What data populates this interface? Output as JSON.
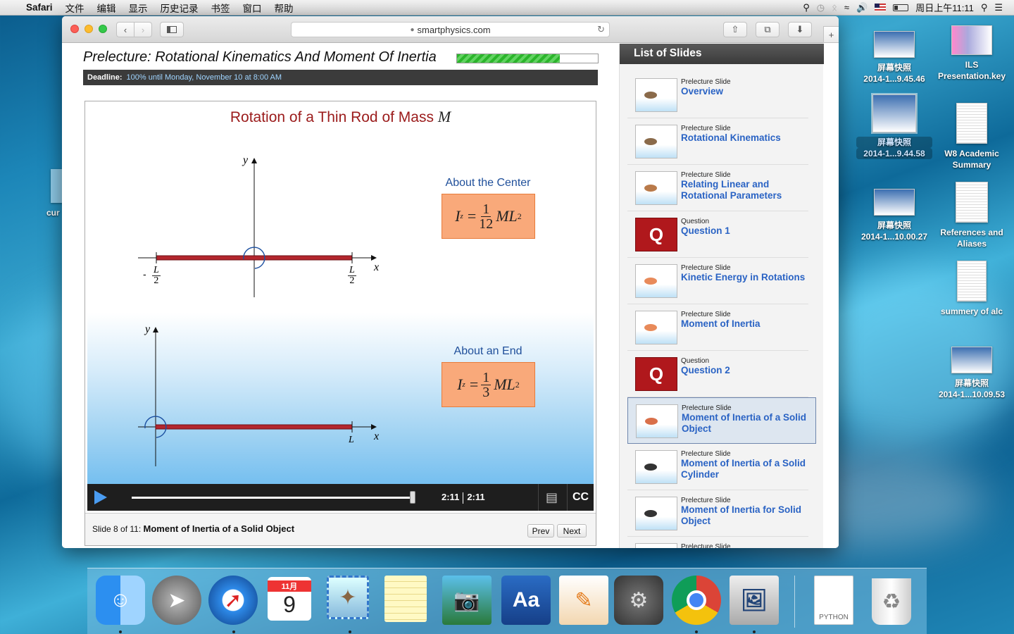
{
  "menubar": {
    "app": "Safari",
    "items": [
      "文件",
      "编辑",
      "显示",
      "历史记录",
      "书签",
      "窗口",
      "帮助"
    ],
    "clock": "周日上午11:11"
  },
  "browser": {
    "url": "smartphysics.com"
  },
  "page": {
    "title": "Prelecture: Rotational Kinematics And Moment Of Inertia",
    "progress": 0.73,
    "deadline_label": "Deadline:",
    "deadline_value": "100% until Monday, November 10 at 8:00 AM"
  },
  "slide": {
    "title": "Rotation of a Thin Rod of Mass",
    "title_var": "M",
    "center_caption": "About the Center",
    "end_caption": "About an End",
    "labels": {
      "y": "y",
      "x": "x",
      "L": "L",
      "two": "2",
      "minus": "-"
    },
    "formula1": {
      "lhs": "I",
      "sub": "z",
      "eq": "=",
      "num": "1",
      "den": "12",
      "rhs": "ML",
      "pow": "2"
    },
    "formula2": {
      "lhs": "I",
      "sub": "z",
      "eq": "=",
      "num": "1",
      "den": "3",
      "rhs": "ML",
      "pow": "2"
    }
  },
  "player": {
    "time_current": "2:11",
    "time_total": "2:11",
    "progress": 0.995,
    "cc": "CC"
  },
  "slidebar": {
    "prefix": "Slide 8 of 11:",
    "name": "Moment of Inertia of a Solid Object",
    "prev": "Prev",
    "next": "Next"
  },
  "sidebar": {
    "heading": "List of Slides",
    "items": [
      {
        "kind": "Prelecture Slide",
        "title": "Overview"
      },
      {
        "kind": "Prelecture Slide",
        "title": "Rotational Kinematics"
      },
      {
        "kind": "Prelecture Slide",
        "title": "Relating Linear and Rotational Parameters"
      },
      {
        "kind": "Question",
        "title": "Question 1"
      },
      {
        "kind": "Prelecture Slide",
        "title": "Kinetic Energy in Rotations"
      },
      {
        "kind": "Prelecture Slide",
        "title": "Moment of Inertia"
      },
      {
        "kind": "Question",
        "title": "Question 2"
      },
      {
        "kind": "Prelecture Slide",
        "title": "Moment of Inertia of a Solid Object"
      },
      {
        "kind": "Prelecture Slide",
        "title": "Moment of Inertia of a Solid Cylinder"
      },
      {
        "kind": "Prelecture Slide",
        "title": "Moment of Inertia for Solid Object"
      },
      {
        "kind": "Prelecture Slide",
        "title": ""
      }
    ],
    "selected_index": 7
  },
  "desktop": {
    "icons": [
      {
        "line1": "屏幕快照",
        "line2": "2014-1...9.45.46"
      },
      {
        "line1": "ILS",
        "line2": "Presentation.key"
      },
      {
        "line1": "屏幕快照",
        "line2": "2014-1...9.44.58"
      },
      {
        "line1": "W8 Academic",
        "line2": "Summary"
      },
      {
        "line1": "屏幕快照",
        "line2": "2014-1...10.00.27"
      },
      {
        "line1": "References and",
        "line2": "Aliases"
      },
      {
        "line1": "summery of alc",
        "line2": ""
      },
      {
        "line1": "屏幕快照",
        "line2": "2014-1...10.09.53"
      },
      {
        "line1": "cur",
        "line2": ""
      }
    ]
  },
  "dock": {
    "calendar_month": "11月",
    "calendar_day": "9",
    "python_label": "PYTHON",
    "letter_q": "Q"
  }
}
